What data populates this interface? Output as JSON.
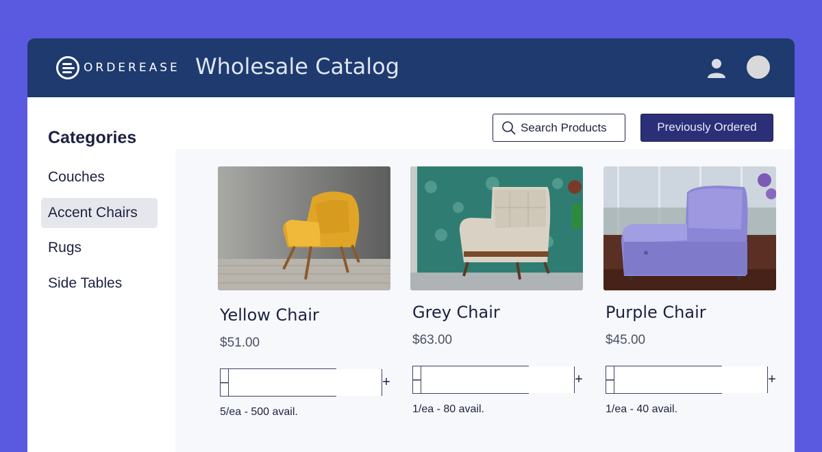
{
  "header": {
    "logo_text": "ORDEREASE",
    "title": "Wholesale Catalog",
    "user_icon": "user-icon",
    "avatar_icon": "avatar"
  },
  "sidebar": {
    "heading": "Categories",
    "items": [
      {
        "label": "Couches",
        "active": false
      },
      {
        "label": "Accent Chairs",
        "active": true
      },
      {
        "label": "Rugs",
        "active": false
      },
      {
        "label": "Side Tables",
        "active": false
      }
    ]
  },
  "toolbar": {
    "search_label": "Search Products",
    "previously_ordered_label": "Previously Ordered"
  },
  "products": [
    {
      "name": "Yellow Chair",
      "price": "$51.00",
      "minus": "–",
      "plus": "+",
      "quantity": "",
      "availability": "5/ea - 500 avail."
    },
    {
      "name": "Grey Chair",
      "price": "$63.00",
      "minus": "–",
      "plus": "+",
      "quantity": "",
      "availability": "1/ea - 80 avail."
    },
    {
      "name": "Purple Chair",
      "price": "$45.00",
      "minus": "–",
      "plus": "+",
      "quantity": "",
      "availability": "1/ea - 40 avail."
    }
  ],
  "colors": {
    "page_bg": "#5a5ae0",
    "header_bg": "#1e3a6e",
    "primary_button": "#2b2f78",
    "text_dark": "#1c2140"
  }
}
